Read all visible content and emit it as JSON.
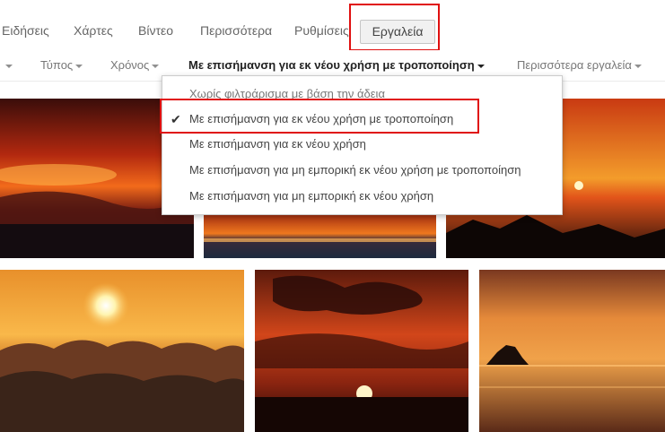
{
  "nav": {
    "items": [
      "Ειδήσεις",
      "Χάρτες",
      "Βίντεο",
      "Περισσότερα",
      "Ρυθμίσεις"
    ],
    "tools_label": "Εργαλεία"
  },
  "tools_row": {
    "type_label": "Τύπος",
    "time_label": "Χρόνος",
    "license_label": "Με επισήμανση για εκ νέου χρήση με τροποποίηση",
    "more_tools_label": "Περισσότερα εργαλεία"
  },
  "license_menu": {
    "options": [
      "Χωρίς φιλτράρισμα με βάση την άδεια",
      "Με επισήμανση για εκ νέου χρήση με τροποποίηση",
      "Με επισήμανση για εκ νέου χρήση",
      "Με επισήμανση για μη εμπορική εκ νέου χρήση με τροποποίηση",
      "Με επισήμανση για μη εμπορική εκ νέου χρήση"
    ],
    "selected_index": 1,
    "check_glyph": "✔"
  },
  "highlight_color": "#e01010",
  "results": {
    "thumbnails": [
      "sunset-clouds",
      "sunset-sea-horizon",
      "sunset-coast-grass",
      "sun-above-clouds",
      "sunset-dark-clouds",
      "sunset-sea-rock"
    ]
  }
}
